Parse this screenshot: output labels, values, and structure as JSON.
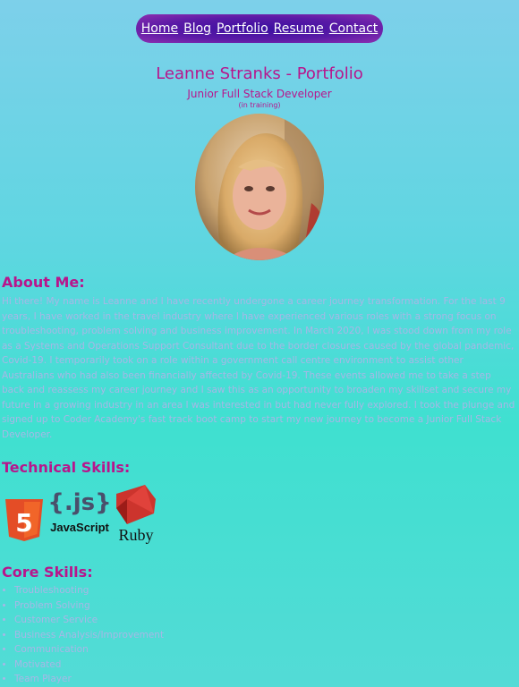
{
  "nav": {
    "items": [
      "Home",
      "Blog",
      "Portfolio",
      "Resume",
      "Contact"
    ]
  },
  "header": {
    "title": "Leanne Stranks - Portfolio",
    "subtitle": "Junior Full Stack Developer",
    "note": "(in training)"
  },
  "about": {
    "heading": "About Me:",
    "text": "Hi there! My name is Leanne and I have recently undergone a career journey transformation. For the last 9 years, I have worked in the travel industry where I have experienced various roles with a strong focus on troubleshooting, problem solving and business improvement. In March 2020, I was stood down from my role as a Systems and Operations Support Consultant due to the border closures caused by the global pandemic, Covid-19. I temporarily took on a role within a government call centre environment to assist other Australians who had also been financially affected by Covid-19. These events allowed me to take a step back and reassess my career journey and I saw this as an opportunity to broaden my skillset and secure my future in a growing industry in an area I was interested in but had never fully explored. I took the plunge and signed up to Coder Academy's fast track boot camp to start my new journey to become a Junior Full Stack Developer."
  },
  "technical": {
    "heading": "Technical Skills:",
    "logos": {
      "html5": "5",
      "js_symbol": "{.js}",
      "js_label": "JavaScript",
      "ruby_label": "Ruby"
    }
  },
  "core": {
    "heading": "Core Skills:",
    "items": [
      "Troubleshooting",
      "Problem Solving",
      "Customer Service",
      "Business Analysis/Improvement",
      "Communication",
      "Motivated",
      "Team Player"
    ]
  },
  "colors": {
    "accent": "#b8158c",
    "nav_bg": "#4a12a3",
    "body_text": "#a7b7e6"
  }
}
